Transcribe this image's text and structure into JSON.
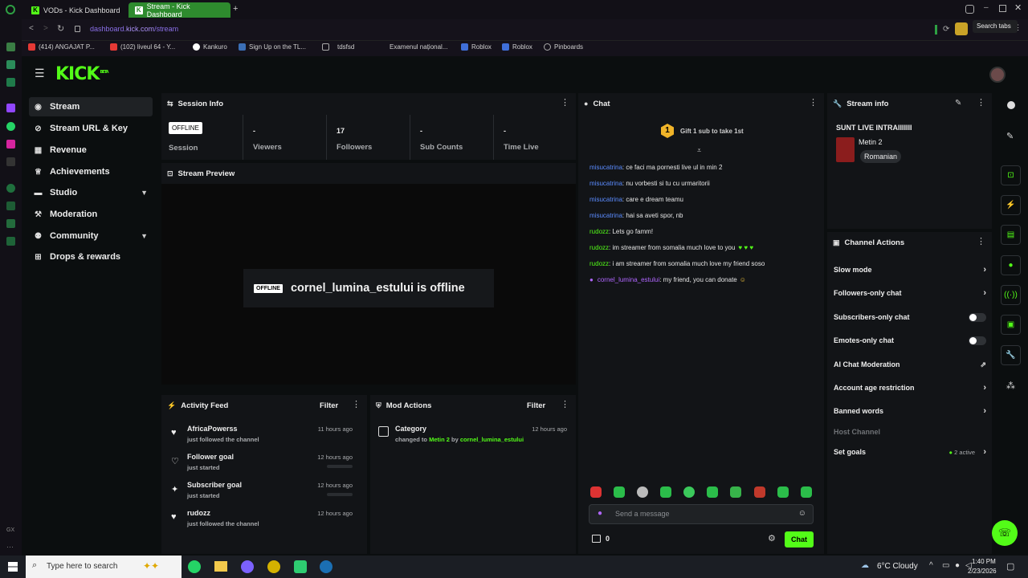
{
  "browser": {
    "tabs": [
      {
        "label": "VODs - Kick Dashboard",
        "active": false
      },
      {
        "label": "Stream - Kick Dashboard",
        "active": true
      }
    ],
    "url_host": "dashboard.",
    "url_main": "kick.com",
    "url_path": "/stream",
    "search_tabs_tooltip": "Search tabs",
    "bookmarks": [
      "(414) ANGAJAT P...",
      "(102) liveul 64 - Y...",
      "Kankuro",
      "Sign Up on the TL...",
      "tdsfsd",
      "Examenul național...",
      "Roblox",
      "Roblox",
      "Pinboards"
    ]
  },
  "kick": {
    "logo": "KICK",
    "logo_badge": "BETA"
  },
  "sidebar": {
    "items": [
      {
        "label": "Stream",
        "icon": "stream-icon",
        "active": true
      },
      {
        "label": "Stream URL & Key",
        "icon": "link-icon"
      },
      {
        "label": "Revenue",
        "icon": "revenue-icon"
      },
      {
        "label": "Achievements",
        "icon": "trophy-icon"
      },
      {
        "label": "Studio",
        "icon": "studio-icon",
        "expandable": true
      },
      {
        "label": "Moderation",
        "icon": "gavel-icon"
      },
      {
        "label": "Community",
        "icon": "community-icon",
        "expandable": true
      },
      {
        "label": "Drops & rewards",
        "icon": "drops-icon"
      }
    ]
  },
  "session_info": {
    "title": "Session Info",
    "status_badge": "OFFLINE",
    "session_label": "Session",
    "stats": [
      {
        "value": "-",
        "label": "Viewers"
      },
      {
        "value": "17",
        "label": "Followers"
      },
      {
        "value": "-",
        "label": "Sub Counts"
      },
      {
        "value": "-",
        "label": "Time Live"
      }
    ]
  },
  "stream_preview": {
    "title": "Stream Preview",
    "badge": "OFFLINE",
    "message": "cornel_lumina_estului is offline"
  },
  "chat": {
    "title": "Chat",
    "gift_count": "1",
    "gift_text": "Gift 1 sub to take 1st",
    "messages": [
      {
        "user": "misucatrina",
        "text": ": ce faci ma pornesti live ul in min 2",
        "color": "blue"
      },
      {
        "user": "misucatrina",
        "text": ": nu vorbesti si tu cu urmaritorii",
        "color": "blue"
      },
      {
        "user": "misucatrina",
        "text": ": care e dream teamu",
        "color": "blue"
      },
      {
        "user": "misucatrina",
        "text": ": hai sa aveti spor, nb",
        "color": "blue"
      },
      {
        "user": "rudozz",
        "text": ": Lets go famm!",
        "color": "green"
      },
      {
        "user": "rudozz",
        "text": ": im streamer from somalia much love to you",
        "color": "green"
      },
      {
        "user": "rudozz",
        "text": ": i am streamer from somalia much love my friend soso",
        "color": "green"
      },
      {
        "user": "cornel_lumina_estului",
        "text": ": my friend, you can donate",
        "color": "purple"
      }
    ],
    "input_placeholder": "Send a message",
    "points": "0",
    "send_label": "Chat"
  },
  "stream_info": {
    "title": "Stream info",
    "stream_title": "SUNT LIVE INTRAIIIIIII",
    "category": "Metin 2",
    "language": "Romanian"
  },
  "channel_actions": {
    "title": "Channel Actions",
    "items": [
      {
        "label": "Slow mode",
        "type": "arrow"
      },
      {
        "label": "Followers-only chat",
        "type": "arrow"
      },
      {
        "label": "Subscribers-only chat",
        "type": "toggle"
      },
      {
        "label": "Emotes-only chat",
        "type": "toggle"
      },
      {
        "label": "AI Chat Moderation",
        "type": "external"
      },
      {
        "label": "Account age restriction",
        "type": "arrow"
      },
      {
        "label": "Banned words",
        "type": "arrow"
      },
      {
        "label": "Host Channel",
        "type": "disabled"
      },
      {
        "label": "Set goals",
        "type": "arrow"
      }
    ],
    "goals_active": "2 active"
  },
  "activity_feed": {
    "title": "Activity Feed",
    "filter_label": "Filter",
    "items": [
      {
        "title": "AfricaPowerss",
        "sub": "just followed the channel",
        "when": "11 hours ago"
      },
      {
        "title": "Follower goal",
        "sub": "just started",
        "when": "12 hours ago"
      },
      {
        "title": "Subscriber goal",
        "sub": "just started",
        "when": "12 hours ago"
      },
      {
        "title": "rudozz",
        "sub": "just followed the channel",
        "when": "12 hours ago"
      }
    ]
  },
  "mod_actions": {
    "title": "Mod Actions",
    "filter_label": "Filter",
    "item_title": "Category",
    "item_when": "12 hours ago",
    "item_prefix": "changed to ",
    "item_category": "Metin 2",
    "item_by": " by ",
    "item_user": "cornel_lumina_estului"
  },
  "taskbar": {
    "search_placeholder": "Type here to search",
    "weather": "6°C Cloudy",
    "time": "1:40 PM",
    "date": "2/23/2026"
  },
  "colors": {
    "accent": "#53fc18",
    "panel": "#121417",
    "background": "#0b0e0f"
  }
}
